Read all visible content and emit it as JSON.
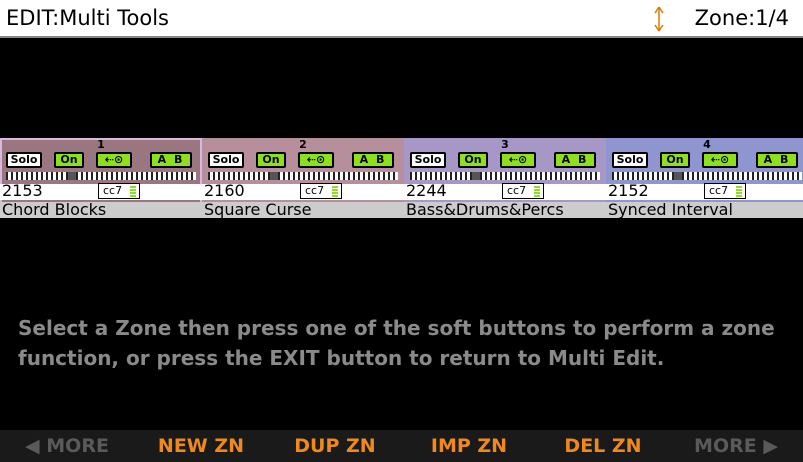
{
  "header": {
    "title": "EDIT:Multi Tools",
    "zone_indicator": "Zone:1/4",
    "updown_icon": "up-down-arrow-icon",
    "updown_color": "#e07a00"
  },
  "zones": [
    {
      "number": "1",
      "solo": "Solo",
      "on": "On",
      "route_icon": "midi-route-icon",
      "ab": "A B",
      "program": "2153",
      "cc": "cc7",
      "name": "Chord Blocks",
      "color": "#9a7780",
      "selected": true
    },
    {
      "number": "2",
      "solo": "Solo",
      "on": "On",
      "route_icon": "midi-route-icon",
      "ab": "A B",
      "program": "2160",
      "cc": "cc7",
      "name": "Square Curse",
      "color": "#b78f9c",
      "selected": false
    },
    {
      "number": "3",
      "solo": "Solo",
      "on": "On",
      "route_icon": "midi-route-icon",
      "ab": "A B",
      "program": "2244",
      "cc": "cc7",
      "name": "Bass&Drums&Percs",
      "color": "#a797c7",
      "selected": false
    },
    {
      "number": "4",
      "solo": "Solo",
      "on": "On",
      "route_icon": "midi-route-icon",
      "ab": "A B",
      "program": "2152",
      "cc": "cc7",
      "name": "Synced Interval",
      "color": "#8e95cf",
      "selected": false
    }
  ],
  "message": "Select a Zone then press one of the soft buttons to perform a zone function, or press the EXIT button to return to Multi Edit.",
  "softbuttons": [
    {
      "label": "◀ MORE",
      "state": "dim"
    },
    {
      "label": "NEW ZN",
      "state": "active"
    },
    {
      "label": "DUP ZN",
      "state": "active"
    },
    {
      "label": "IMP ZN",
      "state": "active"
    },
    {
      "label": "DEL ZN",
      "state": "active"
    },
    {
      "label": "MORE ▶",
      "state": "dim"
    }
  ]
}
